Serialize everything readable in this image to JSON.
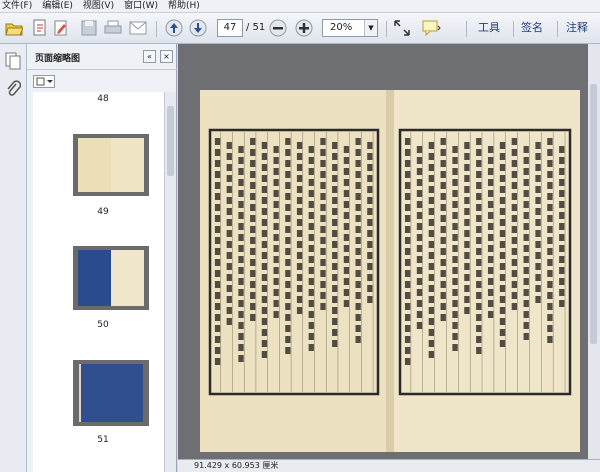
{
  "menu": [
    "文件(F)",
    "编辑(E)",
    "视图(V)",
    "窗口(W)",
    "帮助(H)"
  ],
  "toolbar": {
    "page_current": "47",
    "page_total": "/ 51",
    "zoom": "20%",
    "tools_label": "工具",
    "sign_label": "签名",
    "comment_label": "注释"
  },
  "thumbnails_panel": {
    "title": "页面缩略图",
    "thumbnails": [
      {
        "label": "48"
      },
      {
        "label": "49"
      },
      {
        "label": "50"
      },
      {
        "label": "51"
      }
    ]
  },
  "status": {
    "dimensions": "91.429 x 60.953 厘米"
  },
  "colors": {
    "page_paper": "#ede2c4",
    "blue_cover": "#2b4c8c",
    "doc_bg": "#6d6f72"
  }
}
